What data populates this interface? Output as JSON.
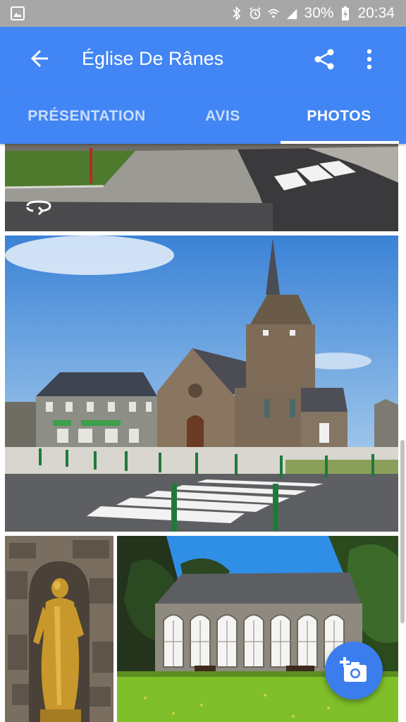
{
  "status_bar": {
    "battery": "30%",
    "time": "20:34",
    "icons": [
      "gallery-notification-icon",
      "bluetooth-icon",
      "alarm-icon",
      "wifi-icon",
      "signal-icon",
      "battery-charging-icon"
    ]
  },
  "app_bar": {
    "title": "Église De Rânes",
    "back_icon": "arrow-back-icon",
    "share_icon": "share-icon",
    "more_icon": "more-vert-icon",
    "color": "#4285f4"
  },
  "tabs": [
    {
      "label": "PRÉSENTATION",
      "active": false
    },
    {
      "label": "AVIS",
      "active": false
    },
    {
      "label": "PHOTOS",
      "active": true
    }
  ],
  "photos": [
    {
      "subject": "street-corner",
      "badge": "360-icon"
    },
    {
      "subject": "church-square"
    },
    {
      "subject": "golden-statue"
    },
    {
      "subject": "orangery-building"
    }
  ],
  "fab": {
    "icon": "add-photo-icon",
    "color": "#3b7ded"
  }
}
